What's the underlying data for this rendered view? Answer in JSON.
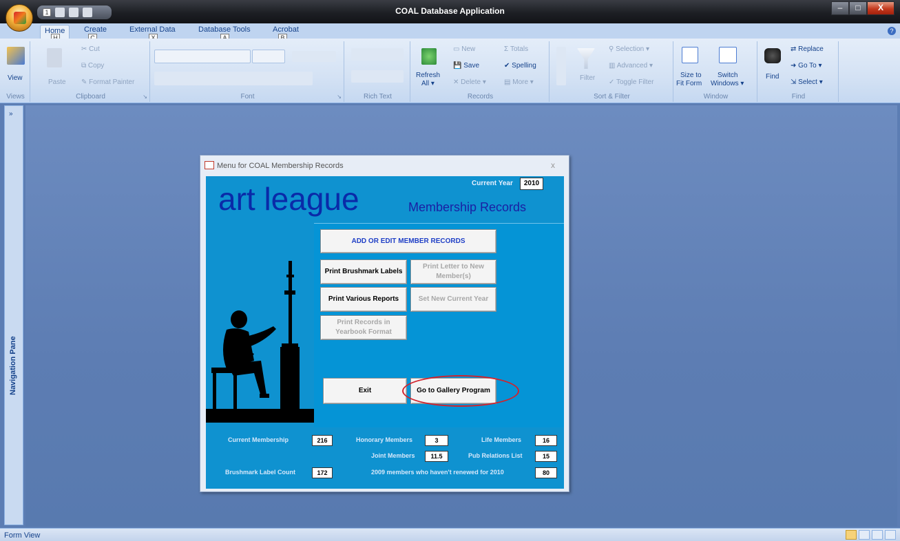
{
  "window": {
    "title": "COAL Database Application",
    "minimize": "–",
    "maximize": "□",
    "close": "X"
  },
  "keytips": {
    "qat1": "1",
    "home": "H",
    "create": "C",
    "external": "X",
    "dbtools": "A",
    "acrobat": "B"
  },
  "tabs": [
    "Home",
    "Create",
    "External Data",
    "Database Tools",
    "Acrobat"
  ],
  "ribbon": {
    "views": {
      "label": "Views",
      "view": "View"
    },
    "clipboard": {
      "label": "Clipboard",
      "paste": "Paste",
      "cut": "Cut",
      "copy": "Copy",
      "format_painter": "Format Painter"
    },
    "font": {
      "label": "Font"
    },
    "rich_text": {
      "label": "Rich Text"
    },
    "records": {
      "label": "Records",
      "refresh": "Refresh",
      "refresh2": "All",
      "new": "New",
      "save": "Save",
      "delete": "Delete",
      "totals": "Totals",
      "spelling": "Spelling",
      "more": "More"
    },
    "sort_filter": {
      "label": "Sort & Filter",
      "filter": "Filter",
      "selection": "Selection",
      "advanced": "Advanced",
      "toggle": "Toggle Filter"
    },
    "window": {
      "label": "Window",
      "size_to_fit": "Size to",
      "size_to_fit2": "Fit Form",
      "switch": "Switch",
      "switch2": "Windows"
    },
    "find": {
      "label": "Find",
      "find": "Find",
      "replace": "Replace",
      "goto": "Go To",
      "select": "Select"
    }
  },
  "nav": {
    "label": "Navigation Pane",
    "toggle": "»"
  },
  "dialog": {
    "title": "Menu for COAL Membership Records",
    "close": "x",
    "brand": "art league",
    "subtitle": "Membership Records",
    "current_year_label": "Current Year",
    "current_year": "2010",
    "buttons": {
      "add_edit": "ADD  OR EDIT MEMBER RECORDS",
      "brushmark": "Print Brushmark Labels",
      "letter": "Print Letter to New Member(s)",
      "reports": "Print Various Reports",
      "new_year": "Set New Current Year",
      "yearbook": "Print Records in Yearbook Format",
      "exit": "Exit",
      "gallery": "Go to Gallery Program"
    },
    "stats": {
      "current_membership_label": "Current Membership",
      "current_membership": "216",
      "honorary_label": "Honorary Members",
      "honorary": "3",
      "life_label": "Life Members",
      "life": "16",
      "joint_label": "Joint Members",
      "joint": "11.5",
      "pub_label": "Pub Relations List",
      "pub": "15",
      "brushmark_count_label": "Brushmark Label Count",
      "brushmark_count": "172",
      "not_renewed_label": "2009 members who haven't renewed for 2010",
      "not_renewed": "80"
    }
  },
  "status": {
    "text": "Form View"
  }
}
